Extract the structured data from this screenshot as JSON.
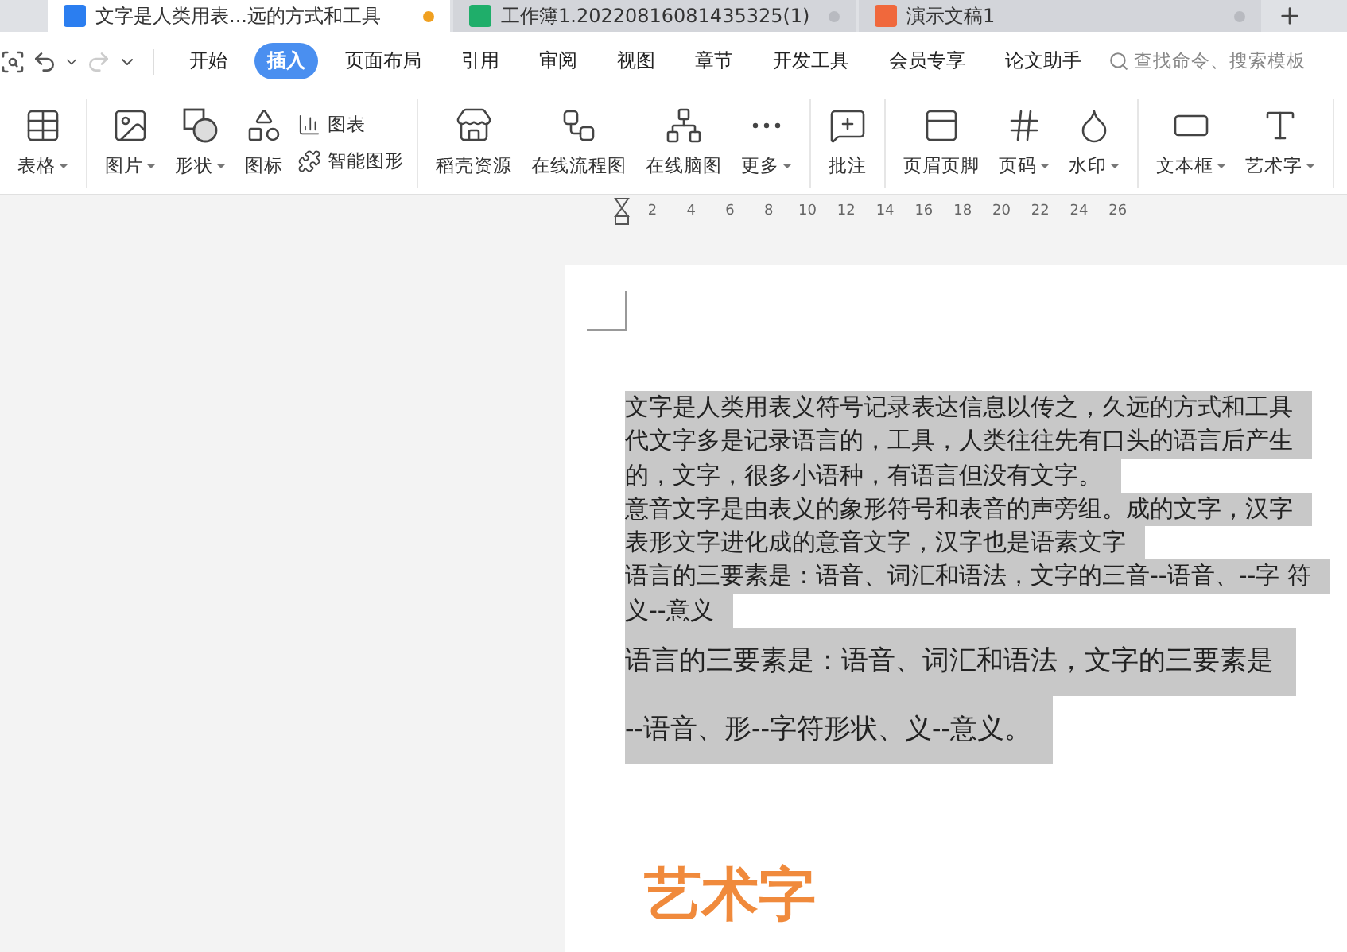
{
  "tabs": [
    {
      "kind": "writer",
      "title": "文字是人类用表...远的方式和工具",
      "selected": true,
      "modified": true
    },
    {
      "kind": "sheet",
      "title": "工作簿1.20220816081435325(1)",
      "selected": false,
      "modified": false
    },
    {
      "kind": "slides",
      "title": "演示文稿1",
      "selected": false,
      "modified": false
    }
  ],
  "menu": {
    "items": [
      {
        "label": "开始",
        "selected": false
      },
      {
        "label": "插入",
        "selected": true
      },
      {
        "label": "页面布局",
        "selected": false
      },
      {
        "label": "引用",
        "selected": false
      },
      {
        "label": "审阅",
        "selected": false
      },
      {
        "label": "视图",
        "selected": false
      },
      {
        "label": "章节",
        "selected": false
      },
      {
        "label": "开发工具",
        "selected": false
      },
      {
        "label": "会员专享",
        "selected": false
      },
      {
        "label": "论文助手",
        "selected": false
      }
    ],
    "search": {
      "placeholder": "查找命令、搜索模板"
    }
  },
  "toolbar": {
    "groups": [
      {
        "items": [
          {
            "kind": "large",
            "label": "表格",
            "dropdown": true
          }
        ]
      },
      {
        "items": [
          {
            "kind": "large",
            "label": "图片",
            "dropdown": true
          },
          {
            "kind": "large",
            "label": "形状",
            "dropdown": true
          },
          {
            "kind": "large",
            "label": "图标",
            "dropdown": false
          },
          {
            "kind": "pair",
            "labels": [
              "图表",
              "智能图形"
            ]
          }
        ]
      },
      {
        "items": [
          {
            "kind": "large",
            "label": "稻壳资源",
            "dropdown": false
          },
          {
            "kind": "large",
            "label": "在线流程图",
            "dropdown": false
          },
          {
            "kind": "large",
            "label": "在线脑图",
            "dropdown": false
          },
          {
            "kind": "large",
            "label": "更多",
            "dropdown": true
          }
        ]
      },
      {
        "items": [
          {
            "kind": "large",
            "label": "批注",
            "dropdown": false
          }
        ]
      },
      {
        "items": [
          {
            "kind": "large",
            "label": "页眉页脚",
            "dropdown": false
          },
          {
            "kind": "large",
            "label": "页码",
            "dropdown": true
          },
          {
            "kind": "large",
            "label": "水印",
            "dropdown": true
          }
        ]
      },
      {
        "items": [
          {
            "kind": "large",
            "label": "文本框",
            "dropdown": true
          },
          {
            "kind": "large",
            "label": "艺术字",
            "dropdown": true
          }
        ]
      }
    ]
  },
  "ruler": {
    "labels": [
      "2",
      "4",
      "6",
      "8",
      "10",
      "12",
      "14",
      "16",
      "18",
      "20",
      "22",
      "24",
      "26"
    ]
  },
  "document": {
    "lines": [
      {
        "kind": "body",
        "text": "文字是人类用表义符号记录表达信息以传之，久远的方式和工具",
        "highlighted": true
      },
      {
        "kind": "body",
        "text": "代文字多是记录语言的，工具，人类往往先有口头的语言后产生",
        "highlighted": true
      },
      {
        "kind": "body",
        "text": "的，文字，很多小语种，有语言但没有文字。",
        "highlighted": true
      },
      {
        "kind": "body",
        "text": "意音文字是由表义的象形符号和表音的声旁组。成的文字，汉字",
        "highlighted": true
      },
      {
        "kind": "body",
        "text": "表形文字进化成的意音文字，汉字也是语素文字",
        "highlighted": true
      },
      {
        "kind": "body",
        "text": "语言的三要素是：语音、词汇和语法，文字的三音--语音、--字 符",
        "highlighted": true
      },
      {
        "kind": "body",
        "text": "义--意义",
        "highlighted": true
      },
      {
        "kind": "large",
        "text": "语言的三要素是：语音、词汇和语法，文字的三要素是",
        "highlighted": true
      },
      {
        "kind": "large",
        "text": "--语音、形--字符形状、义--意义。",
        "highlighted": true
      }
    ],
    "art_text": "艺术字"
  }
}
